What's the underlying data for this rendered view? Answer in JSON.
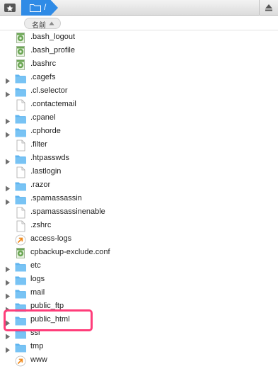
{
  "toolbar": {
    "path_label": "/"
  },
  "header": {
    "name_column": "名前"
  },
  "files": [
    {
      "name": ".bash_logout",
      "kind": "script"
    },
    {
      "name": ".bash_profile",
      "kind": "script"
    },
    {
      "name": ".bashrc",
      "kind": "script"
    },
    {
      "name": ".cagefs",
      "kind": "folder"
    },
    {
      "name": ".cl.selector",
      "kind": "folder"
    },
    {
      "name": ".contactemail",
      "kind": "file"
    },
    {
      "name": ".cpanel",
      "kind": "folder"
    },
    {
      "name": ".cphorde",
      "kind": "folder"
    },
    {
      "name": ".filter",
      "kind": "file"
    },
    {
      "name": ".htpasswds",
      "kind": "folder"
    },
    {
      "name": ".lastlogin",
      "kind": "file"
    },
    {
      "name": ".razor",
      "kind": "folder"
    },
    {
      "name": ".spamassassin",
      "kind": "folder"
    },
    {
      "name": ".spamassassinenable",
      "kind": "file"
    },
    {
      "name": ".zshrc",
      "kind": "file"
    },
    {
      "name": "access-logs",
      "kind": "alias"
    },
    {
      "name": "cpbackup-exclude.conf",
      "kind": "script"
    },
    {
      "name": "etc",
      "kind": "folder"
    },
    {
      "name": "logs",
      "kind": "folder"
    },
    {
      "name": "mail",
      "kind": "folder"
    },
    {
      "name": "public_ftp",
      "kind": "folder"
    },
    {
      "name": "public_html",
      "kind": "folder",
      "highlighted": true
    },
    {
      "name": "ssl",
      "kind": "folder"
    },
    {
      "name": "tmp",
      "kind": "folder"
    },
    {
      "name": "www",
      "kind": "alias"
    }
  ],
  "colors": {
    "accent": "#2f8be6",
    "highlight": "#ff3d7a",
    "folder": "#5fb4ef"
  }
}
